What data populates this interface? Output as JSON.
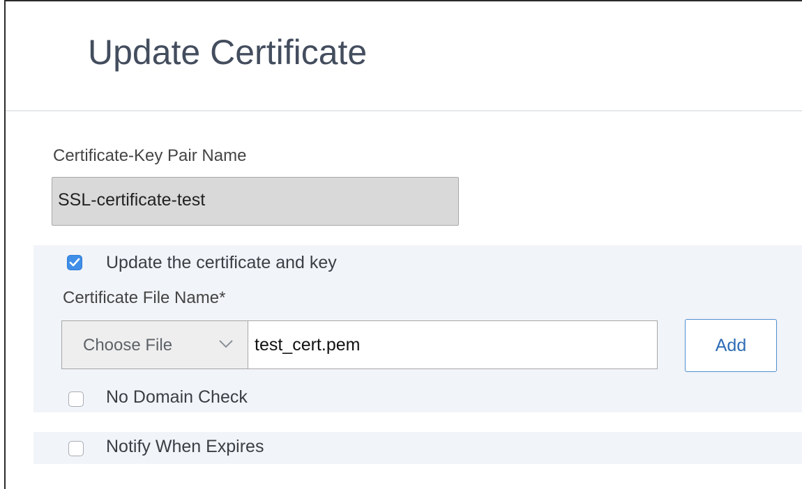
{
  "dialog": {
    "title": "Update Certificate"
  },
  "form": {
    "keypair_label": "Certificate-Key Pair Name",
    "keypair_value": "SSL-certificate-test",
    "update_checkbox_label": "Update the certificate and key",
    "update_checked": true,
    "cert_file_label": "Certificate File Name*",
    "choose_file_label": "Choose File",
    "cert_file_value": "test_cert.pem",
    "add_button_label": "Add",
    "no_domain_check_label": "No Domain Check",
    "no_domain_check_checked": false,
    "notify_label": "Notify When Expires",
    "notify_checked": false
  },
  "colors": {
    "accent": "#3f8ee8",
    "title": "#434d5e",
    "panel": "#f1f4f8",
    "button_text": "#2e6cb5"
  },
  "icons": {
    "checked": "checkmark-icon",
    "dropdown": "chevron-down-icon"
  }
}
